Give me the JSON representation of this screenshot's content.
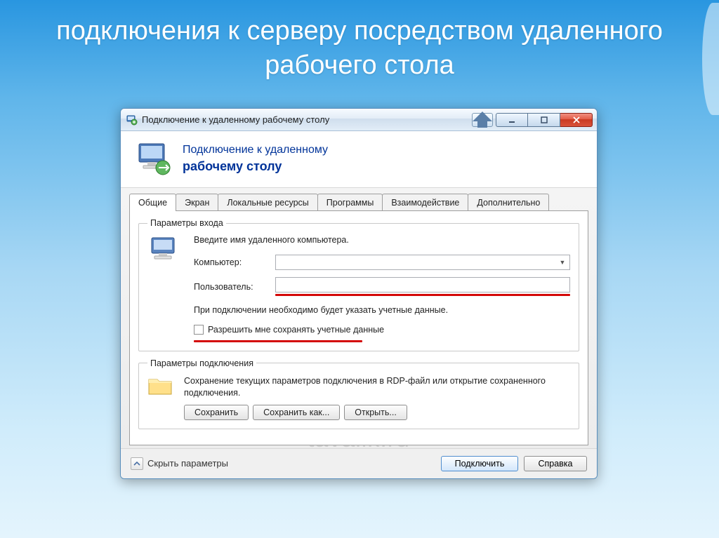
{
  "slide": {
    "title": "подключения к серверу посредством удаленного рабочего стола"
  },
  "window": {
    "title": "Подключение к удаленному рабочему столу",
    "header_line1": "Подключение к удаленному",
    "header_line2": "рабочему столу"
  },
  "tabs": [
    "Общие",
    "Экран",
    "Локальные ресурсы",
    "Программы",
    "Взаимодействие",
    "Дополнительно"
  ],
  "login": {
    "legend": "Параметры входа",
    "instruction": "Введите имя удаленного компьютера.",
    "computer_label": "Компьютер:",
    "computer_value": "",
    "user_label": "Пользователь:",
    "user_value": "",
    "note": "При подключении необходимо будет указать учетные данные.",
    "save_creds_label": "Разрешить мне сохранять учетные данные"
  },
  "connection": {
    "legend": "Параметры подключения",
    "text": "Сохранение текущих параметров подключения в RDP-файл или открытие сохраненного подключения.",
    "save_btn": "Сохранить",
    "save_as_btn": "Сохранить как...",
    "open_btn": "Открыть..."
  },
  "footer": {
    "hide_options": "Скрыть параметры",
    "connect_btn": "Подключить",
    "help_btn": "Справка"
  },
  "watermark": "tavalik.ru"
}
